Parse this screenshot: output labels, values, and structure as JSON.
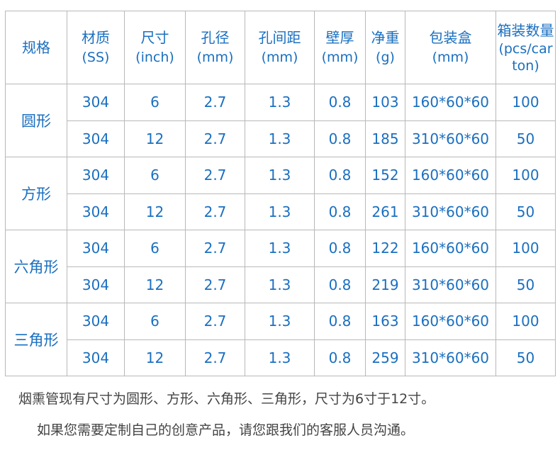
{
  "table": {
    "headers": [
      {
        "label": "规格",
        "unit": ""
      },
      {
        "label": "材质",
        "unit": "(SS)"
      },
      {
        "label": "尺寸",
        "unit": "(inch)"
      },
      {
        "label": "孔径",
        "unit": "(mm)"
      },
      {
        "label": "孔间距",
        "unit": "(mm)"
      },
      {
        "label": "壁厚",
        "unit": "(mm)"
      },
      {
        "label": "净重",
        "unit": "(g)"
      },
      {
        "label": "包装盒",
        "unit": "(mm)"
      },
      {
        "label": "箱装数量",
        "unit": "(pcs/carton)"
      }
    ],
    "groups": [
      {
        "name": "圆形",
        "rows": [
          [
            "304",
            "6",
            "2.7",
            "1.3",
            "0.8",
            "103",
            "160*60*60",
            "100"
          ],
          [
            "304",
            "12",
            "2.7",
            "1.3",
            "0.8",
            "185",
            "310*60*60",
            "50"
          ]
        ]
      },
      {
        "name": "方形",
        "rows": [
          [
            "304",
            "6",
            "2.7",
            "1.3",
            "0.8",
            "152",
            "160*60*60",
            "100"
          ],
          [
            "304",
            "12",
            "2.7",
            "1.3",
            "0.8",
            "261",
            "310*60*60",
            "50"
          ]
        ]
      },
      {
        "name": "六角形",
        "rows": [
          [
            "304",
            "6",
            "2.7",
            "1.3",
            "0.8",
            "122",
            "160*60*60",
            "100"
          ],
          [
            "304",
            "12",
            "2.7",
            "1.3",
            "0.8",
            "219",
            "310*60*60",
            "50"
          ]
        ]
      },
      {
        "name": "三角形",
        "rows": [
          [
            "304",
            "6",
            "2.7",
            "1.3",
            "0.8",
            "163",
            "160*60*60",
            "100"
          ],
          [
            "304",
            "12",
            "2.7",
            "1.3",
            "0.8",
            "259",
            "310*60*60",
            "50"
          ]
        ]
      }
    ]
  },
  "notes": {
    "line1": "烟熏管现有尺寸为圆形、方形、六角形、三角形，尺寸为6寸于12寸。",
    "line2": "如果您需要定制自己的创意产品，请您跟我们的客服人员沟通。"
  },
  "colors": {
    "table_text": "#1a6fc0",
    "note_text": "#444444",
    "border": "#b8b8b8"
  }
}
